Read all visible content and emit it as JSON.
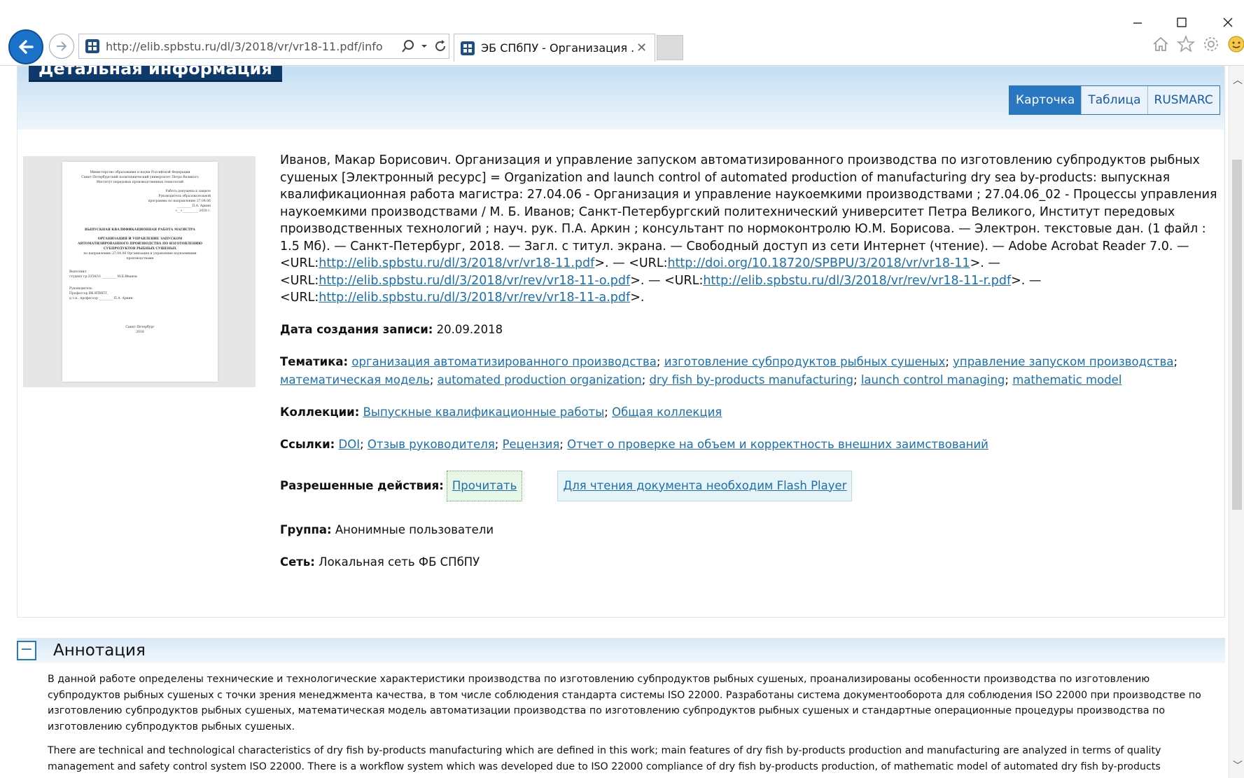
{
  "window": {
    "controls": {
      "minimize": "—",
      "maximize": "☐",
      "close": "✕"
    }
  },
  "browser": {
    "address_url": "http://elib.spbstu.ru/dl/3/2018/vr/vr18-11.pdf/info",
    "tab_title": "ЭБ СПбПУ - Организация ...",
    "tab_close": "✕",
    "icons": [
      "back-arrow-icon",
      "forward-arrow-icon",
      "search-icon",
      "refresh-icon",
      "home-icon",
      "favorites-star-icon",
      "settings-gear-icon",
      "smiley-feedback-icon"
    ]
  },
  "detail": {
    "title": "Детальная информация",
    "view_tabs": [
      {
        "label": "Карточка",
        "active": true
      },
      {
        "label": "Таблица",
        "active": false
      },
      {
        "label": "RUSMARC",
        "active": false
      }
    ],
    "cover": {
      "lines": [
        "Министерство образования и науки Российской Федерации",
        "Санкт-Петербургский политехнический университет Петра Великого",
        "Институт передовых производственных технологий",
        "Работа допущена к защите",
        "Руководитель образовательной",
        "программы по направлению 27.04.06",
        "_________ П.А. Аркин",
        "«__»__________ 2018 г.",
        "ВЫПУСКНАЯ КВАЛИФИКАЦИОННАЯ РАБОТА МАГИСТРА",
        "ОРГАНИЗАЦИЯ И УПРАВЛЕНИЕ ЗАПУСКОМ",
        "АВТОМАТИЗИРОВАННОГО ПРОИЗВОДСТВА ПО ИЗГОТОВЛЕНИЮ",
        "СУБПРОДУКТОВ РЫБНЫХ СУШЕНЫХ",
        "по направлению 27.04.06 Организация и управление наукоемкими",
        "производствами",
        "Выполнил",
        "студент гр.3354/11 _________ М.Б.Иванов",
        "Руководитель",
        "Профессор ВК ИТИПТ,",
        "д.т.н., профессор _________ П.А. Аркин",
        "Санкт-Петербург",
        "2018"
      ]
    },
    "citation": {
      "text": "Иванов, Макар Борисович. Организация и управление запуском автоматизированного производства по изготовлению субпродуктов рыбных сушеных [Электронный ресурс] = Organization and launch control of automated production of manufacturing dry sea by-products: выпускная квалификационная работа магистра: 27.04.06 - Организация и управление наукоемкими производствами ; 27.04.06_02 - Процессы управления наукоемкими производствами / М. Б. Иванов; Санкт-Петербургский политехнический университет Петра Великого, Институт передовых производственных технологий ; науч. рук. П.А. Аркин ; консультант по нормоконтролю Ю.М. Борисова. — Электрон. текстовые дан. (1 файл : 1.5 Мб). — Санкт-Петербург, 2018. — Загл. с титул. экрана. — Свободный доступ из сети Интернет (чтение). — Adobe Acrobat Reader 7.0. — ",
      "url_prefix": "<URL:",
      "url_suffix": ">. — ",
      "url_last_suffix": ">.",
      "urls": [
        "http://elib.spbstu.ru/dl/3/2018/vr/vr18-11.pdf",
        "http://doi.org/10.18720/SPBPU/3/2018/vr/vr18-11",
        "http://elib.spbstu.ru/dl/3/2018/vr/rev/vr18-11-o.pdf",
        "http://elib.spbstu.ru/dl/3/2018/vr/rev/vr18-11-r.pdf",
        "http://elib.spbstu.ru/dl/3/2018/vr/rev/vr18-11-a.pdf"
      ]
    },
    "created": {
      "label": "Дата создания записи:",
      "value": "20.09.2018"
    },
    "subjects": {
      "label": "Тематика:",
      "items": [
        "организация автоматизированного производства",
        "изготовление субпродуктов рыбных сушеных",
        "управление запуском производства",
        "математическая модель",
        "automated production organization",
        "dry fish by-products manufacturing",
        "launch control managing",
        "mathematic model"
      ]
    },
    "collections": {
      "label": "Коллекции:",
      "items": [
        "Выпускные квалификационные работы",
        "Общая коллекция"
      ]
    },
    "links": {
      "label": "Ссылки:",
      "items": [
        "DOI",
        "Отзыв руководителя",
        "Рецензия",
        "Отчет о проверке на объем и корректность внешних заимствований"
      ]
    },
    "actions": {
      "label": "Разрешенные действия:",
      "read": "Прочитать",
      "flash": "Для чтения документа необходим Flash Player"
    },
    "group": {
      "label": "Группа:",
      "value": "Анонимные пользователи"
    },
    "network": {
      "label": "Сеть:",
      "value": "Локальная сеть ФБ СПбПУ"
    }
  },
  "annotation": {
    "toggle": "−",
    "title": "Аннотация",
    "paragraphs": [
      "В данной работе определены технические и технологические характеристики производства по изготовлению субпродуктов рыбных сушеных, проанализированы особенности производства по изготовлению субпродуктов рыбных сушеных с точки зрения менеджмента качества, в том числе соблюдения стандарта системы ISO 22000. Разработаны система документооборота для соблюдения ISO 22000 при производстве по изготовлению субпродуктов рыбных сушеных, математическая модель автоматизации производства по изготовлению субпродуктов рыбных сушеных и стандартные операционные процедуры производства по изготовлению субпродуктов рыбных сушеных.",
      "There are technical and technological characteristics of dry fish by-products manufacturing which are defined in this work; main features of dry fish by-products production and manufacturing are analyzed in terms of quality management and safety control system ISO 22000. There is a workflow system which was developed due to ISO 22000 compliance of dry fish by-products production, of mathematic model of automated dry fish by-products"
    ]
  }
}
